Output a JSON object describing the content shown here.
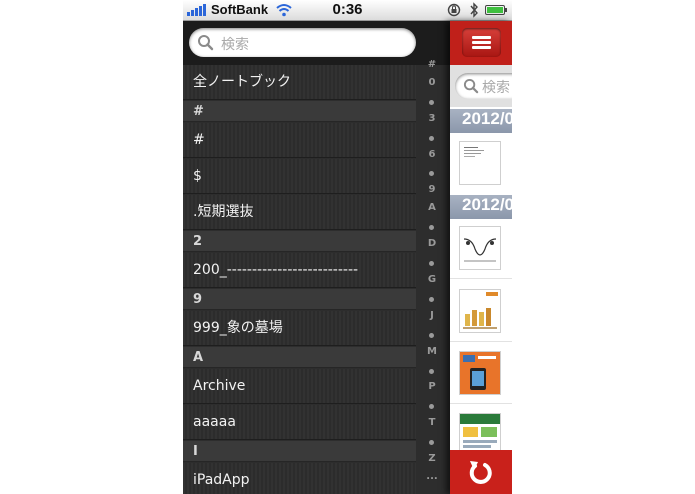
{
  "status": {
    "carrier": "SoftBank",
    "time": "0:36"
  },
  "search": {
    "placeholder": "検索"
  },
  "notebooks": [
    {
      "kind": "item",
      "label": "全ノートブック"
    },
    {
      "kind": "header",
      "label": "#"
    },
    {
      "kind": "item",
      "label": "#"
    },
    {
      "kind": "item",
      "label": "$"
    },
    {
      "kind": "item",
      "label": ".短期選抜"
    },
    {
      "kind": "header",
      "label": "2"
    },
    {
      "kind": "item",
      "label": "200_--------------------------"
    },
    {
      "kind": "header",
      "label": "9"
    },
    {
      "kind": "item",
      "label": "999_象の墓場"
    },
    {
      "kind": "header",
      "label": "A"
    },
    {
      "kind": "item",
      "label": "Archive"
    },
    {
      "kind": "item",
      "label": "aaaaa"
    },
    {
      "kind": "header",
      "label": "I"
    },
    {
      "kind": "item",
      "label": "iPadApp"
    }
  ],
  "index_bar": [
    "#",
    "0",
    "•",
    "3",
    "•",
    "6",
    "•",
    "9",
    "A",
    "•",
    "D",
    "•",
    "G",
    "•",
    "J",
    "•",
    "M",
    "•",
    "P",
    "•",
    "T",
    "•",
    "Z",
    "..."
  ],
  "notes_panel": {
    "search_placeholder": "検索",
    "date_headers": [
      "2012/0",
      "2012/0"
    ]
  },
  "colors": {
    "accent_red": "#c0201a",
    "dark_bg": "#2d2d2d",
    "date_header": "#97a2b5"
  },
  "icons": [
    "signal-icon",
    "wifi-icon",
    "lock-rotation-icon",
    "bluetooth-icon",
    "battery-icon",
    "search-icon",
    "hamburger-menu-icon",
    "refresh-icon"
  ]
}
